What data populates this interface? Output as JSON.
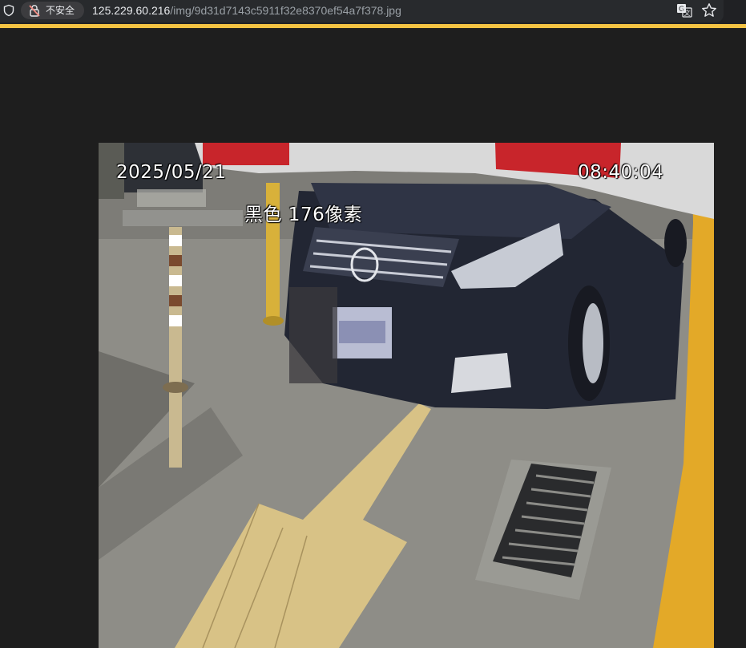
{
  "browser": {
    "security_label": "不安全",
    "url_host": "125.229.60.216",
    "url_path": "/img/9d31d7143c5911f32e8370ef54a7f378.jpg",
    "icons": {
      "shield": "shield-icon",
      "lock": "lock-warning-icon",
      "translate": "translate-icon",
      "bookmark": "star-icon"
    },
    "accent_color": "#f4c343"
  },
  "photo": {
    "overlay_date": "2025/05/21",
    "overlay_time": "08:40:04",
    "overlay_plate_info": "黑色 176像素"
  }
}
